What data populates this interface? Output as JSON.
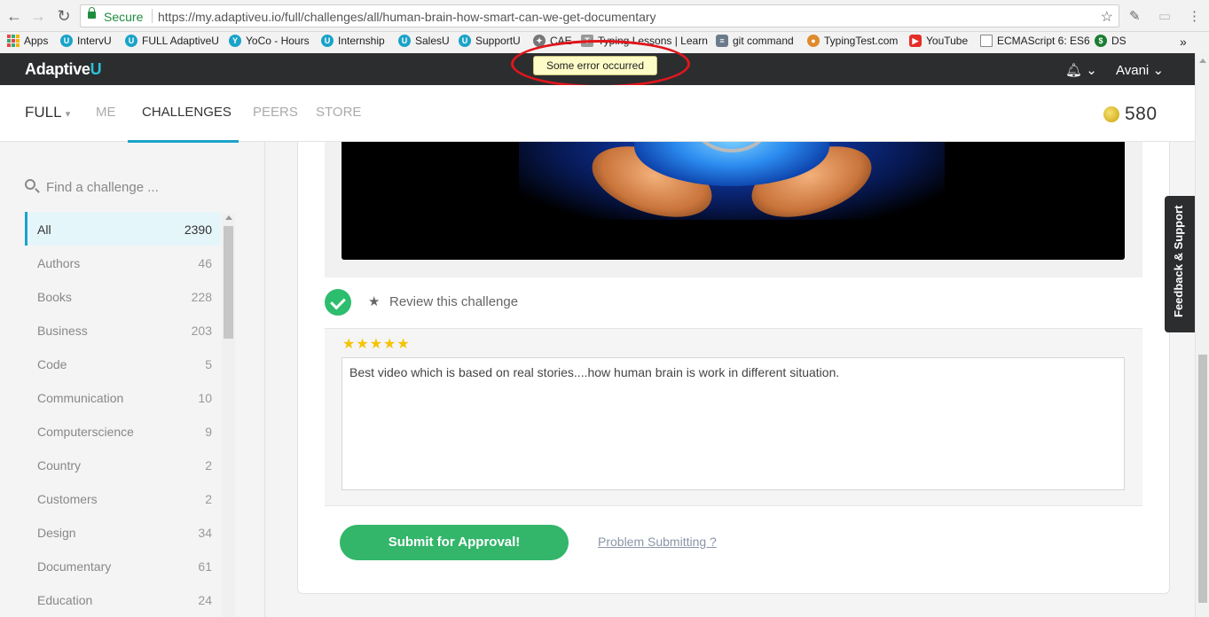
{
  "browser": {
    "secure_label": "Secure",
    "url": "https://my.adaptiveu.io/full/challenges/all/human-brain-how-smart-can-we-get-documentary",
    "bookmarks": [
      "Apps",
      "IntervU",
      "FULL AdaptiveU",
      "YoCo - Hours",
      "Internship",
      "SalesU",
      "SupportU",
      "CAE",
      "Typing Lessons | Learn",
      "git command",
      "TypingTest.com",
      "YouTube",
      "ECMAScript 6: ES6",
      "DS"
    ],
    "more": "»"
  },
  "header": {
    "logo_main": "Adaptive",
    "logo_accent": "U",
    "toast": "Some error occurred",
    "user_name": "Avani",
    "caret": "⌄"
  },
  "tabs": {
    "brand": "FULL",
    "items": [
      "ME",
      "CHALLENGES",
      "PEERS",
      "STORE"
    ],
    "active": "CHALLENGES",
    "coins": "580"
  },
  "sidebar": {
    "search_placeholder": "Find a challenge ...",
    "categories": [
      {
        "label": "All",
        "count": "2390"
      },
      {
        "label": "Authors",
        "count": "46"
      },
      {
        "label": "Books",
        "count": "228"
      },
      {
        "label": "Business",
        "count": "203"
      },
      {
        "label": "Code",
        "count": "5"
      },
      {
        "label": "Communication",
        "count": "10"
      },
      {
        "label": "Computerscience",
        "count": "9"
      },
      {
        "label": "Country",
        "count": "2"
      },
      {
        "label": "Customers",
        "count": "2"
      },
      {
        "label": "Design",
        "count": "34"
      },
      {
        "label": "Documentary",
        "count": "61"
      },
      {
        "label": "Education",
        "count": "24"
      }
    ]
  },
  "main": {
    "review_label": "Review this challenge",
    "rating": 5,
    "stars": "★★★★★",
    "review_text": "Best video which is based on real stories....how human brain is work in different situation.",
    "submit_label": "Submit for Approval!",
    "problem_link": "Problem Submitting ?"
  },
  "feedback_tab": "Feedback & Support",
  "colors": {
    "accent": "#1aa3c9",
    "header_bg": "#2b2d2f",
    "submit": "#33b56a",
    "annotation": "#e0161c",
    "toast_bg": "#fdfbc6"
  }
}
